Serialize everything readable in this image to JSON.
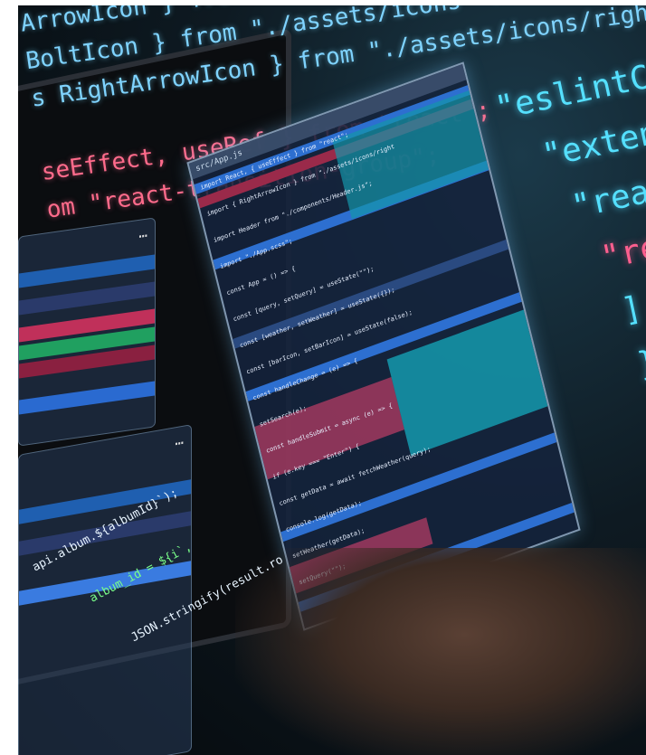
{
  "foreground_code": {
    "line1": "ArrowIcon } from \"./assets/icons/",
    "line2": "BoltIcon } from \"./assets/icons\" from \"./assets/icons/right",
    "line3": "s RightArrowIcon } from \"./assets/icons/right",
    "line4": "seEffect, useRef } from \"react\";",
    "line5": "om \"react-transition-group\";"
  },
  "right_code": {
    "line1": "\"eslintCon",
    "line2": "\"exten",
    "line3": "\"rea",
    "line4": "\"re",
    "line5": "]",
    "line6": "},"
  },
  "floating_panel": {
    "header": "src/App.js",
    "lines": [
      "import React, { useEffect } from \"react\";",
      "import { RightArrowIcon } from \"./assets/icons/right",
      "import Header from \"./components/Header.js\";",
      "import \"./App.scss\";",
      "const App = () => {",
      "const [query, setQuery] = useState(\"\");",
      "const [weather, setWeather] = useState({});",
      "const [barIcon, setBarIcon] = useState(false);",
      "const handleChange = (e) => {",
      "setSearch(e);",
      "const handleSubmit = async (e) => {",
      "if (e.key === \"Enter\") {",
      "const getData = await fetchWeather(query);",
      "console.log(getData);",
      "setWeather(getData);",
      "setQuery(\"\");"
    ]
  },
  "bottom_code": {
    "line1": "api.album.${albumId}`);",
    "line2": "album_id = ${i`,",
    "line3": "JSON.stringify(result.ro"
  },
  "panels": {
    "dots": "…"
  }
}
